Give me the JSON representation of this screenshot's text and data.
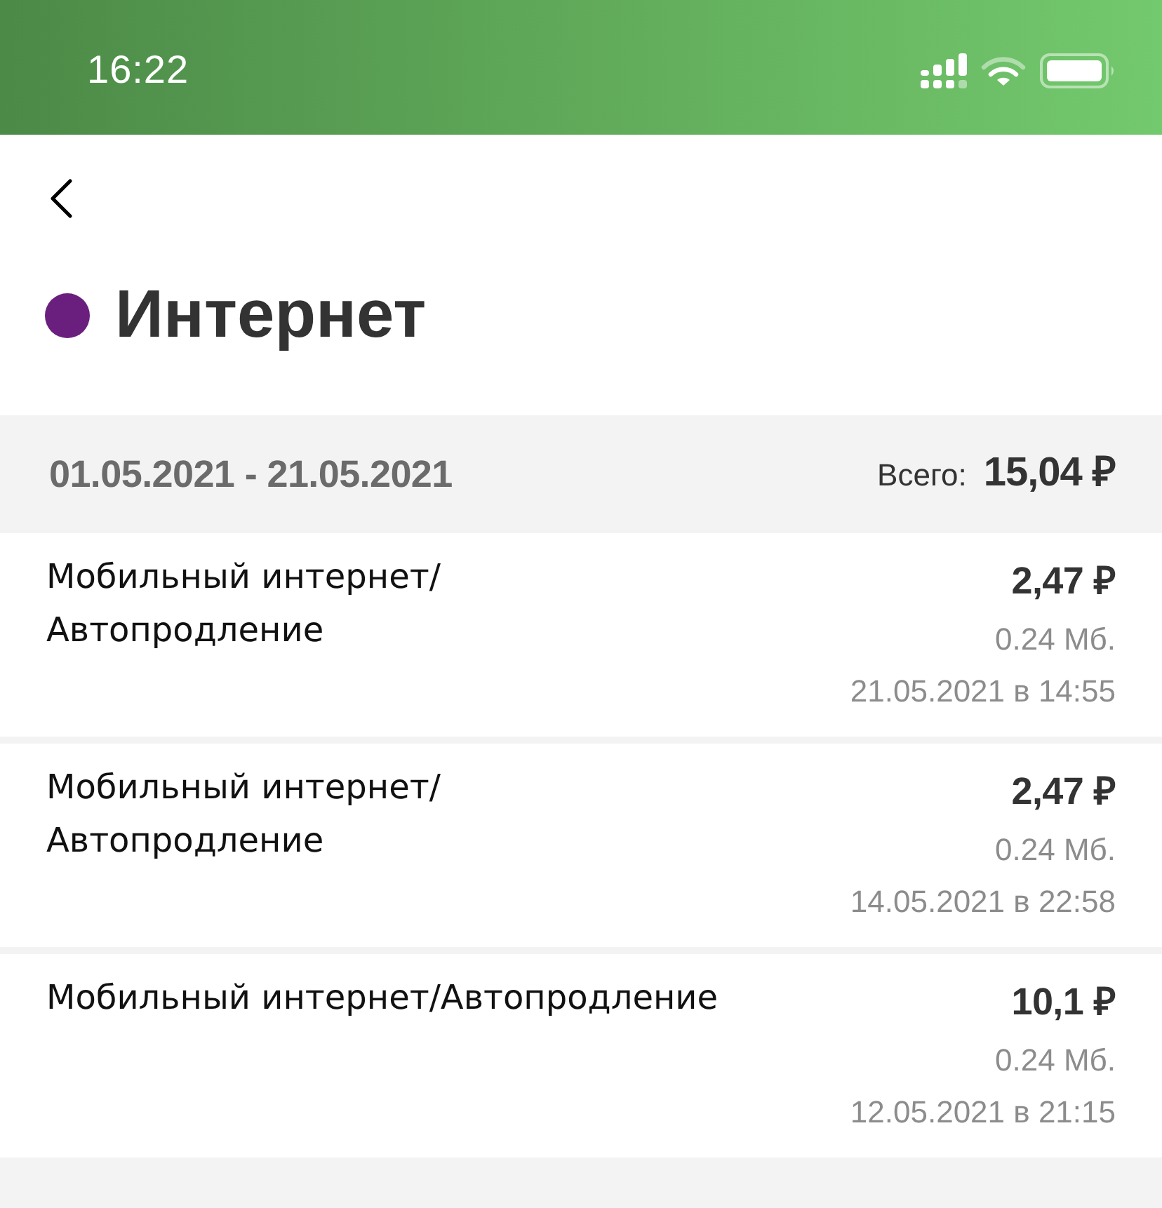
{
  "status_bar": {
    "time": "16:22"
  },
  "header": {
    "title": "Интернет",
    "color": "#6a1f7f"
  },
  "period": {
    "range": "01.05.2021 - 21.05.2021",
    "total_label": "Всего:",
    "total": "15,04 ₽"
  },
  "charges": [
    {
      "title": "Мобильный интернет/\nАвтопродление",
      "amount": "2,47 ₽",
      "volume": "0.24 Мб.",
      "datetime": "21.05.2021 в 14:55"
    },
    {
      "title": "Мобильный интернет/\nАвтопродление",
      "amount": "2,47 ₽",
      "volume": "0.24 Мб.",
      "datetime": "14.05.2021 в 22:58"
    },
    {
      "title": "Мобильный интернет/Автопродление",
      "amount": "10,1 ₽",
      "volume": "0.24 Мб.",
      "datetime": "12.05.2021 в 21:15"
    }
  ]
}
